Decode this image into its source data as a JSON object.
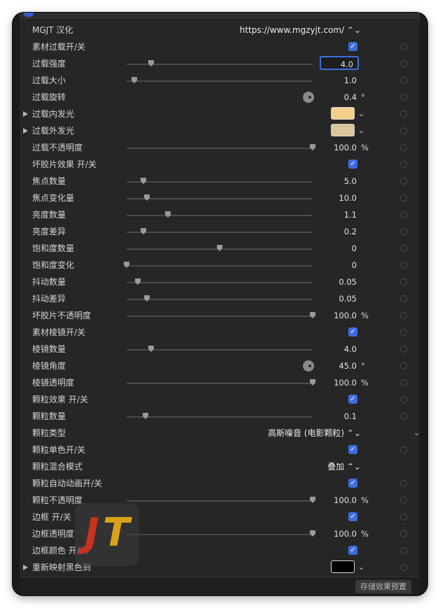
{
  "header": {
    "url": "https://www.mgzyjt.com/"
  },
  "logo": {
    "text_j": "J",
    "text_t": "T"
  },
  "rows": [
    {
      "label": "MGJT 汉化",
      "kind": "popup",
      "value": "https://www.mgzyjt.com/ ⌃⌄"
    },
    {
      "label": "素材过载开/关",
      "kind": "checkbox",
      "checked": true
    },
    {
      "label": "过载强度",
      "kind": "slider",
      "value": "4.0",
      "level": 0.13,
      "focused": true
    },
    {
      "label": "过载大小",
      "kind": "slider",
      "value": "1.0",
      "level": 0.04
    },
    {
      "label": "过载旋转",
      "kind": "dial",
      "value": "0.4",
      "unit": "°"
    },
    {
      "label": "过载内发光",
      "kind": "color",
      "color": "#f4cf8c",
      "expandable": true
    },
    {
      "label": "过载外发光",
      "kind": "color",
      "color": "#d9c69a",
      "expandable": true
    },
    {
      "label": "过载不透明度",
      "kind": "slider",
      "value": "100.0",
      "unit": "%",
      "level": 1.0
    },
    {
      "label": "坏胶片效果 开/关",
      "kind": "checkbox",
      "checked": true
    },
    {
      "label": "焦点数量",
      "kind": "slider",
      "value": "5.0",
      "level": 0.09
    },
    {
      "label": "焦点变化量",
      "kind": "slider",
      "value": "10.0",
      "level": 0.11
    },
    {
      "label": "亮度数量",
      "kind": "slider",
      "value": "1.1",
      "level": 0.22
    },
    {
      "label": "亮度差异",
      "kind": "slider",
      "value": "0.2",
      "level": 0.09
    },
    {
      "label": "饱和度数量",
      "kind": "slider",
      "value": "0",
      "level": 0.5
    },
    {
      "label": "饱和度变化",
      "kind": "slider",
      "value": "0",
      "level": 0.0
    },
    {
      "label": "抖动数量",
      "kind": "slider",
      "value": "0.05",
      "level": 0.06
    },
    {
      "label": "抖动差异",
      "kind": "slider",
      "value": "0.05",
      "level": 0.11
    },
    {
      "label": "坏胶片不透明度",
      "kind": "slider",
      "value": "100.0",
      "unit": "%",
      "level": 1.0
    },
    {
      "label": "素材棱镜开/关",
      "kind": "checkbox",
      "checked": true
    },
    {
      "label": "棱镜数量",
      "kind": "slider",
      "value": "4.0",
      "level": 0.13
    },
    {
      "label": "棱镜角度",
      "kind": "dial",
      "value": "45.0",
      "unit": "°"
    },
    {
      "label": "棱镜透明度",
      "kind": "slider",
      "value": "100.0",
      "unit": "%",
      "level": 1.0
    },
    {
      "label": "颗粒效果 开/关",
      "kind": "checkbox",
      "checked": true
    },
    {
      "label": "颗粒数量",
      "kind": "slider",
      "value": "0.1",
      "level": 0.1
    },
    {
      "label": "颗粒类型",
      "kind": "popup",
      "value": "高斯噪音 (电影颗粒) ⌃⌄",
      "far_chevron": true
    },
    {
      "label": "颗粒单色开/关",
      "kind": "checkbox",
      "checked": true
    },
    {
      "label": "颗粒混合模式",
      "kind": "popup",
      "value": "叠加 ⌃⌄"
    },
    {
      "label": "颗粒自动动画开/关",
      "kind": "checkbox",
      "checked": true
    },
    {
      "label": "颗粒不透明度",
      "kind": "slider",
      "value": "100.0",
      "unit": "%",
      "level": 1.0
    },
    {
      "label": "边框 开/关",
      "kind": "checkbox",
      "checked": true
    },
    {
      "label": "边框透明度",
      "kind": "slider",
      "value": "100.0",
      "unit": "%",
      "level": 1.0
    },
    {
      "label": "边框颜色 开/关",
      "kind": "checkbox",
      "checked": true
    },
    {
      "label": "重新映射黑色到",
      "kind": "color",
      "color": "#000000",
      "expandable": true
    }
  ],
  "footer": {
    "save_preset_label": "存储效果预置"
  },
  "colors": {
    "accent": "#3f6de0",
    "panel_bg": "#262626",
    "window_bg": "#1b1b1b"
  }
}
